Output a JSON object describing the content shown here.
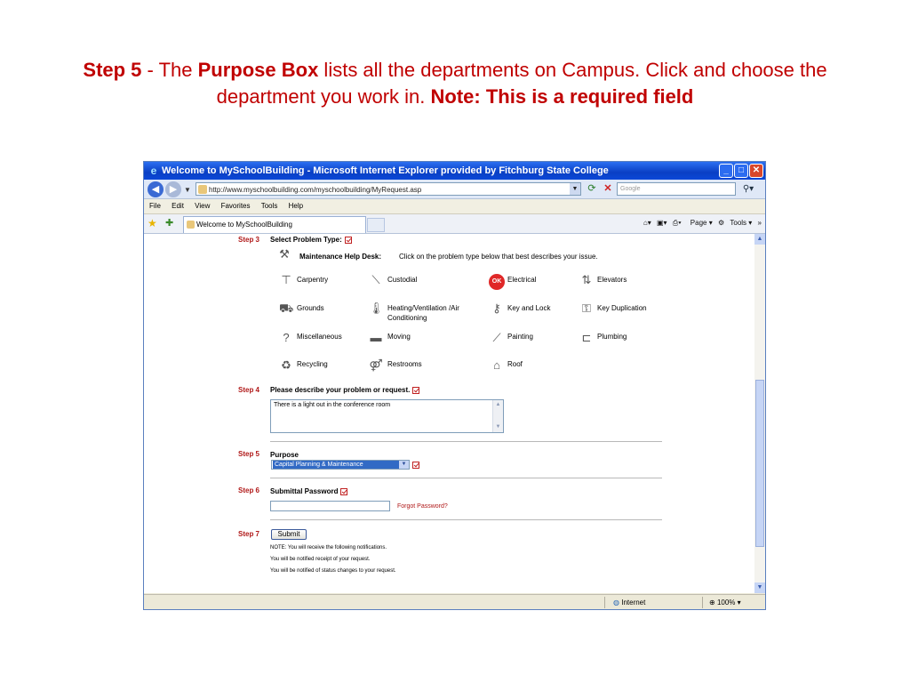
{
  "slide": {
    "step_label": "Step  5",
    "dash_text": " - The ",
    "purpose_box": "Purpose Box",
    "rest_text": " lists all the departments on Campus.   Click and choose the department you work in.  ",
    "note": "Note: This is a required field"
  },
  "browser": {
    "title": "Welcome to MySchoolBuilding - Microsoft Internet Explorer provided by Fitchburg State College",
    "url": "http://www.myschoolbuilding.com/myschoolbuilding/MyRequest.asp",
    "search_placeholder": "Google",
    "menu": [
      "File",
      "Edit",
      "View",
      "Favorites",
      "Tools",
      "Help"
    ],
    "tab_title": "Welcome to MySchoolBuilding",
    "toolbar_page": "Page",
    "toolbar_tools": "Tools",
    "status_zone": "Internet",
    "zoom": "100%"
  },
  "form": {
    "step3": {
      "label": "Step 3",
      "title": "Select Problem Type:"
    },
    "help_desk": {
      "title": "Maintenance Help Desk:",
      "desc": "Click on the problem type below that best describes your issue."
    },
    "problems": {
      "carpentry": "Carpentry",
      "custodial": "Custodial",
      "electrical": "Electrical",
      "elevators": "Elevators",
      "grounds": "Grounds",
      "hvac": "Heating/Ventilation /Air Conditioning",
      "key_lock": "Key and Lock",
      "key_dup": "Key Duplication",
      "misc": "Miscellaneous",
      "moving": "Moving",
      "painting": "Painting",
      "plumbing": "Plumbing",
      "recycling": "Recycling",
      "restrooms": "Restrooms",
      "roof": "Roof"
    },
    "ok_badge": "OK",
    "step4": {
      "label": "Step 4",
      "title": "Please describe your problem or request.",
      "value": "There is a light out in the conference room"
    },
    "step5": {
      "label": "Step 5",
      "title": "Purpose",
      "selected": "Capital Planning & Maintenance"
    },
    "step6": {
      "label": "Step 6",
      "title": "Submittal Password",
      "forgot": "Forgot Password?"
    },
    "step7": {
      "label": "Step 7",
      "submit": "Submit"
    },
    "notes": [
      "NOTE: You will receive the following notifications.",
      "You will be notified receipt of your request.",
      "You will be notified of status changes to your request."
    ]
  }
}
